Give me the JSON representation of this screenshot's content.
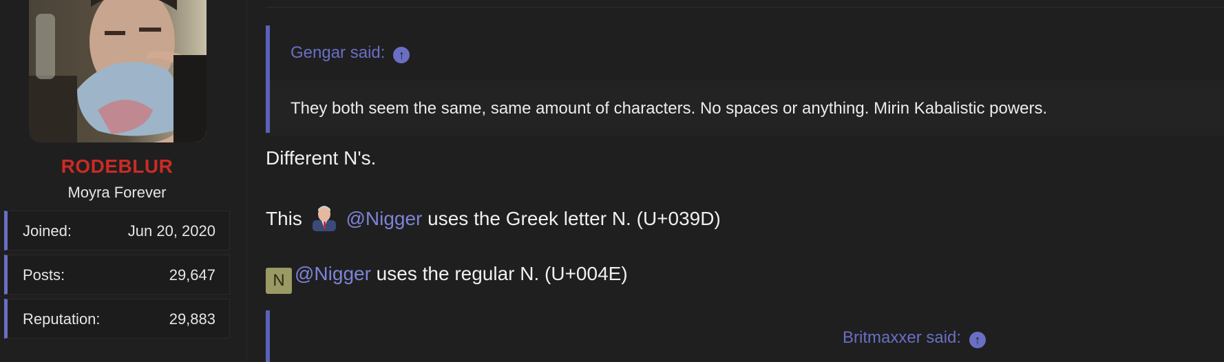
{
  "user": {
    "username": "RODEBLUR",
    "title": "Moyra Forever",
    "username_color": "#cc2b25",
    "stats": [
      {
        "key": "Joined:",
        "value": "Jun 20, 2020"
      },
      {
        "key": "Posts:",
        "value": "29,647"
      },
      {
        "key": "Reputation:",
        "value": "29,883"
      }
    ]
  },
  "quote1": {
    "attribution": "Gengar said:",
    "text": "They both seem the same, same amount of characters. No spaces or anything. Mirin Kabalistic powers."
  },
  "message": {
    "line1": "Different N's.",
    "line2_prefix": "This",
    "line2_mention": "@Nigger",
    "line2_suffix": " uses the Greek letter N. (U+039D)",
    "line3_badge": "N",
    "line3_mention": "@Nigger",
    "line3_suffix": " uses the regular N. (U+004E)"
  },
  "quote2": {
    "attribution": "Britmaxxer said:"
  },
  "colors": {
    "accent": "#6a6fc4",
    "background": "#1f1f20"
  },
  "icons": {
    "quote_jump": "arrow-up-circle-icon"
  }
}
